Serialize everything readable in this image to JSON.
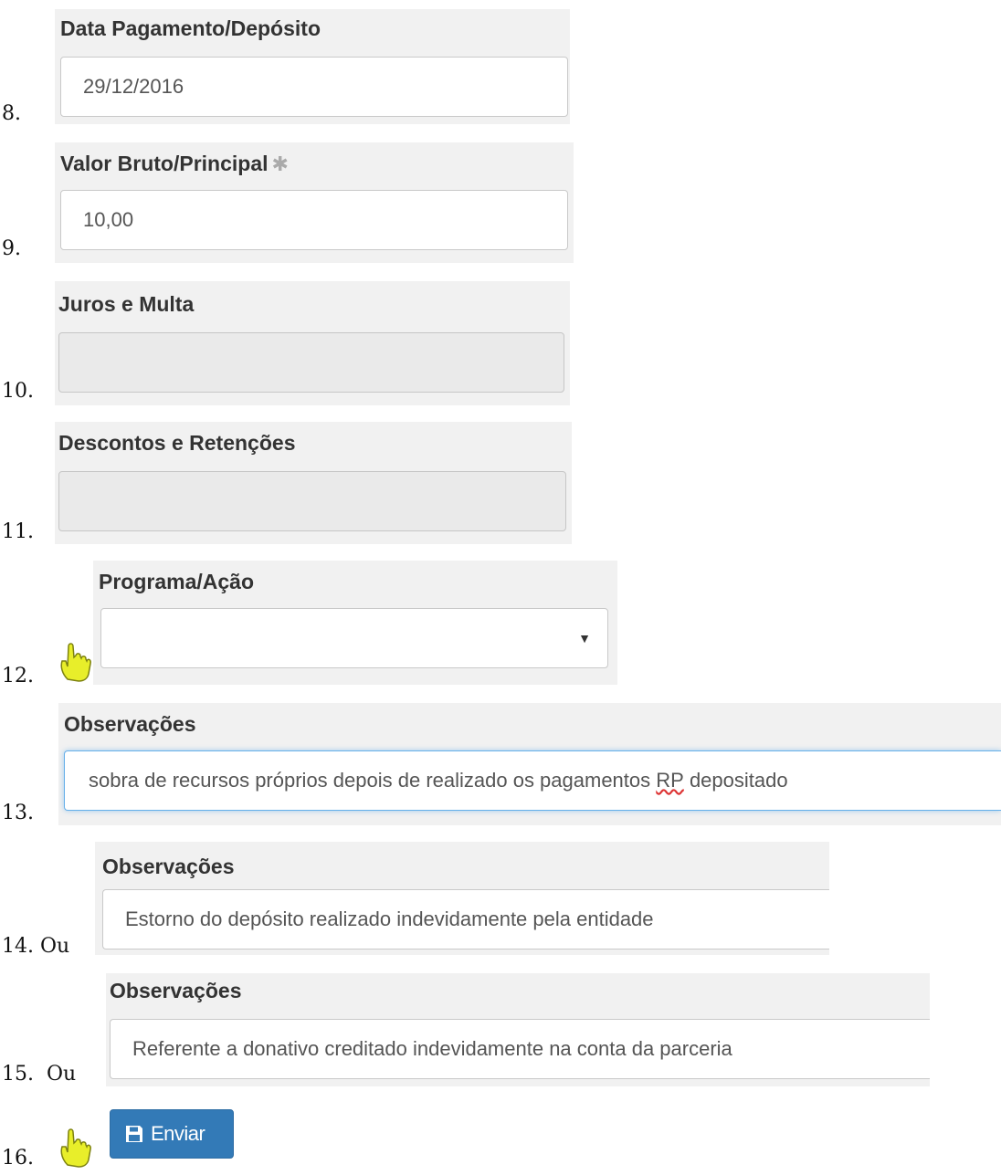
{
  "steps": [
    {
      "number": "8.",
      "label": "Data Pagamento/Depósito",
      "value": "29/12/2016"
    },
    {
      "number": "9.",
      "label": "Valor Bruto/Principal",
      "required_mark": "✱",
      "value": "10,00"
    },
    {
      "number": "10.",
      "label": "Juros e Multa",
      "value": ""
    },
    {
      "number": "11.",
      "label": "Descontos e Retenções",
      "value": ""
    },
    {
      "number": "12.",
      "label": "Programa/Ação",
      "value": ""
    },
    {
      "number": "13.",
      "label": "Observações",
      "value_before": "sobra de recursos próprios depois de realizado os pagamentos ",
      "value_flagged": "RP",
      "value_after": " depositado"
    },
    {
      "number": "14. Ou",
      "label": "Observações",
      "value": "Estorno do depósito realizado indevidamente pela entidade"
    },
    {
      "number": "15.  Ou",
      "label": "Observações",
      "value": "Referente a donativo creditado indevidamente na conta da parceria"
    },
    {
      "number": "16.",
      "button_label": "Enviar"
    }
  ],
  "icons": {
    "pointer": "pointing-hand-icon",
    "save": "floppy-disk-icon",
    "dropdown": "caret-down-icon"
  },
  "colors": {
    "primary_button": "#337ab7",
    "focus_border": "#66afe9",
    "panel_bg": "#f1f1f1",
    "pointer_hand": "#e8ee2a"
  }
}
